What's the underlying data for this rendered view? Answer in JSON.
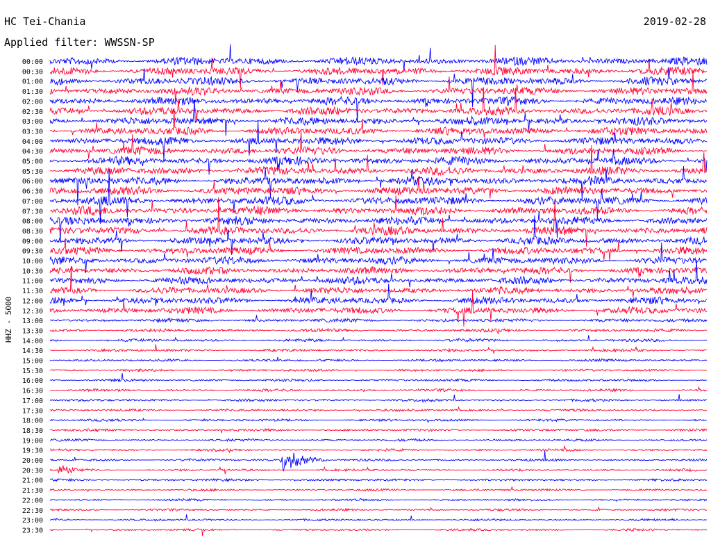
{
  "chart_data": {
    "type": "line",
    "title": "HC Tei-Chania",
    "date": "2019-02-28",
    "filter_label": "Applied filter: WWSSN-SP",
    "ylabel": "HHZ - 5000",
    "grid": false,
    "row_labels": [
      "00:00",
      "00:30",
      "01:00",
      "01:30",
      "02:00",
      "02:30",
      "03:00",
      "03:30",
      "04:00",
      "04:30",
      "05:00",
      "05:30",
      "06:00",
      "06:30",
      "07:00",
      "07:30",
      "08:00",
      "08:30",
      "09:00",
      "09:30",
      "10:00",
      "10:30",
      "11:00",
      "11:30",
      "12:00",
      "12:30",
      "13:00",
      "13:30",
      "14:00",
      "14:30",
      "15:00",
      "15:30",
      "16:00",
      "16:30",
      "17:00",
      "17:30",
      "18:00",
      "18:30",
      "19:00",
      "19:30",
      "20:00",
      "20:30",
      "21:00",
      "21:30",
      "22:00",
      "22:30",
      "23:00",
      "23:30"
    ],
    "row_activity": [
      0.95,
      0.95,
      0.95,
      0.95,
      0.95,
      0.95,
      0.95,
      0.95,
      0.95,
      0.95,
      0.95,
      0.95,
      1.0,
      1.0,
      1.0,
      1.0,
      0.95,
      0.95,
      0.9,
      0.9,
      0.9,
      0.85,
      0.85,
      0.8,
      0.8,
      0.8,
      0.42,
      0.38,
      0.34,
      0.32,
      0.3,
      0.3,
      0.3,
      0.3,
      0.3,
      0.3,
      0.3,
      0.3,
      0.28,
      0.28,
      0.28,
      0.28,
      0.28,
      0.26,
      0.26,
      0.26,
      0.26,
      0.26
    ],
    "colors": [
      "#0000ff",
      "#ff0033"
    ],
    "events": [
      {
        "row": "20:00",
        "start_fraction": 0.35,
        "duration_fraction": 0.07,
        "amplitude": 3.2
      },
      {
        "row": "20:30",
        "start_fraction": 0.01,
        "duration_fraction": 0.07,
        "amplitude": 1.4
      }
    ]
  }
}
